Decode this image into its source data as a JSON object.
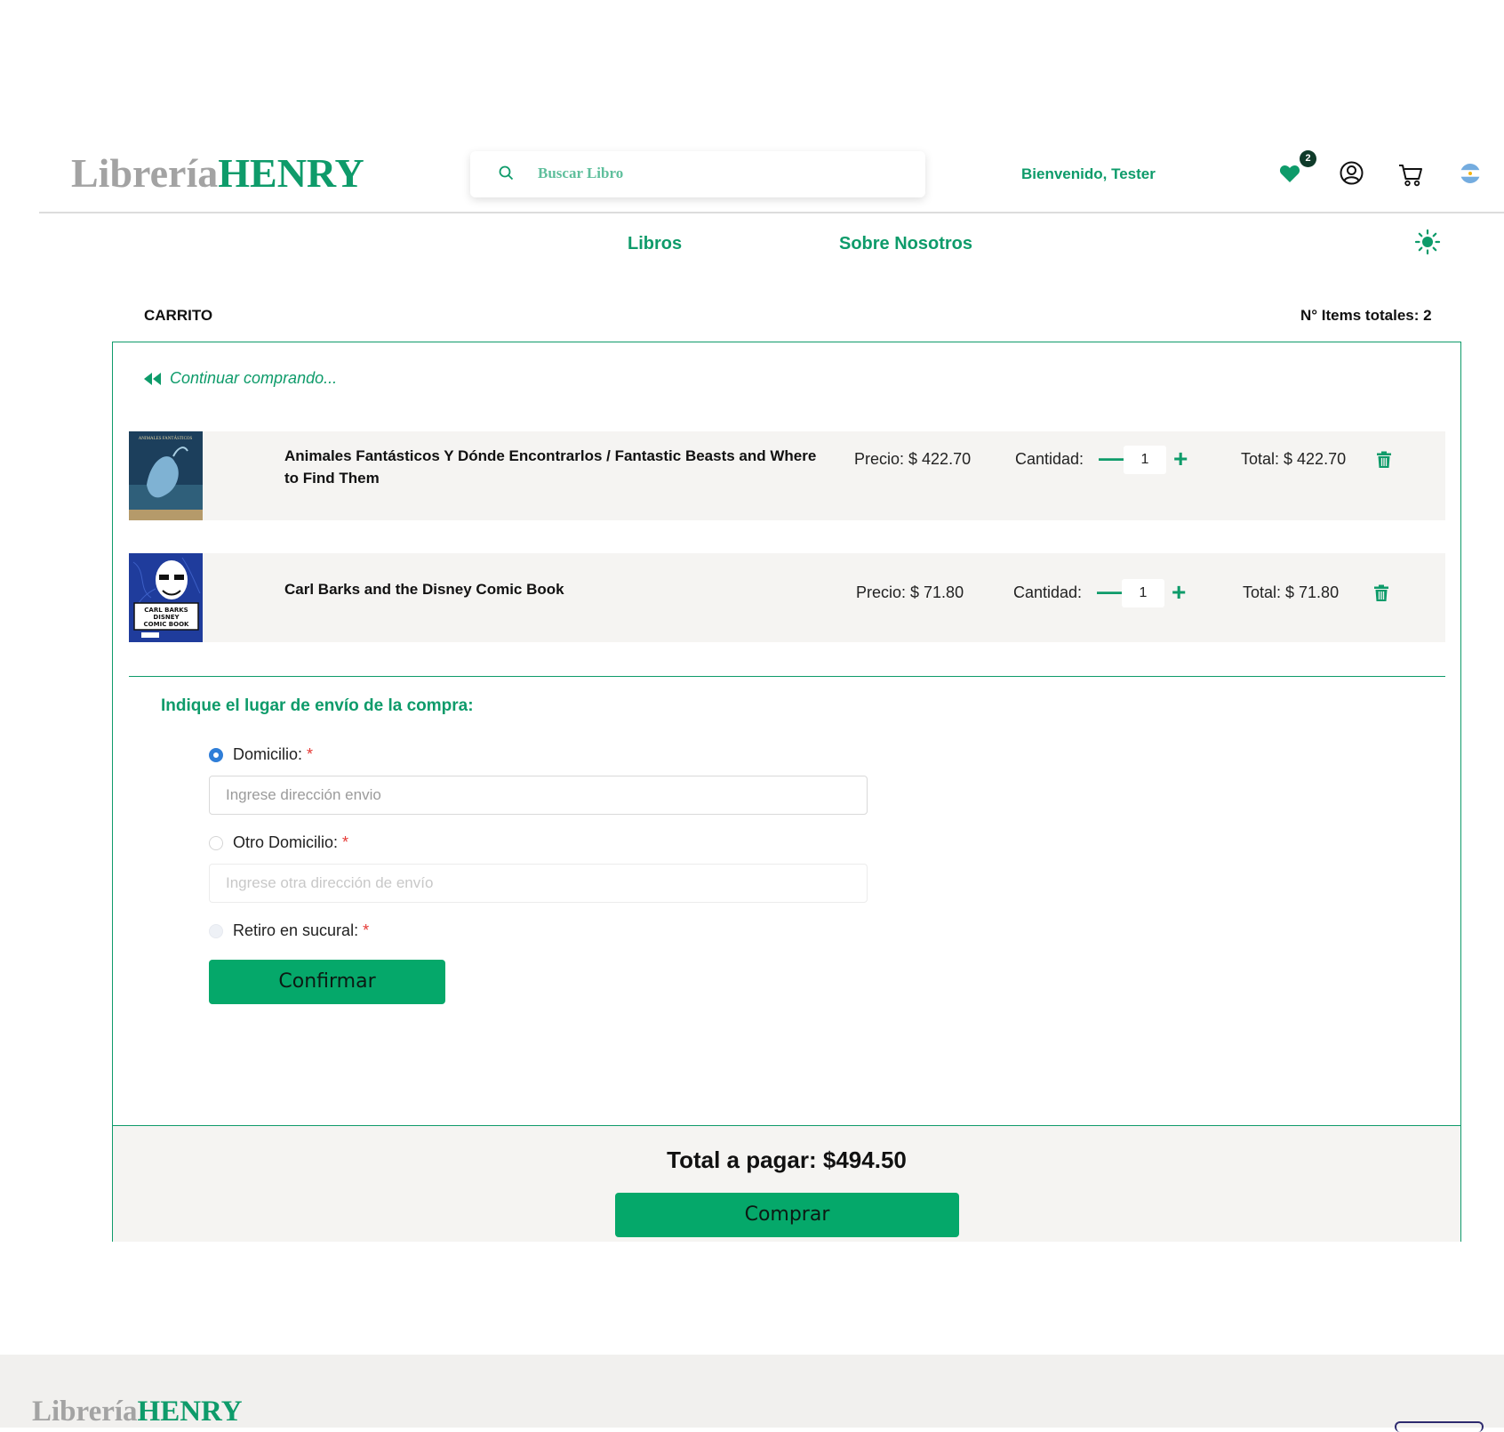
{
  "header": {
    "logo_part1": "Librería",
    "logo_part2": "HENRY",
    "search_placeholder": "Buscar Libro",
    "welcome": "Bienvenido, Tester",
    "favorites_count": "2"
  },
  "nav": {
    "books": "Libros",
    "about": "Sobre Nosotros"
  },
  "cart": {
    "title": "CARRITO",
    "items_total": "N° Items totales: 2",
    "continue_label": "Continuar comprando...",
    "items": [
      {
        "title": "Animales Fantásticos Y Dónde Encontrarlos / Fantastic Beasts and Where to Find Them",
        "price": "Precio: $ 422.70",
        "qty_label": "Cantidad:",
        "qty": "1",
        "total": "Total: $ 422.70"
      },
      {
        "title": "Carl Barks and the Disney Comic Book",
        "price": "Precio: $ 71.80",
        "qty_label": "Cantidad:",
        "qty": "1",
        "total": "Total: $ 71.80"
      }
    ],
    "book1_cover_text": "ANIMALES FANTÁSTICOS",
    "book2_cover_text": [
      "CARL BARKS",
      "DISNEY",
      "COMIC BOOK"
    ]
  },
  "shipping": {
    "title": "Indique el lugar de envío de la compra:",
    "option_home": "Domicilio:",
    "home_placeholder": "Ingrese dirección envio",
    "option_other": "Otro Domicilio:",
    "other_placeholder": "Ingrese otra dirección de envío",
    "option_pickup": "Retiro en sucural:",
    "required_mark": "*",
    "confirm_label": "Confirmar"
  },
  "summary": {
    "total_label": "Total a pagar: $494.50",
    "buy_label": "Comprar"
  },
  "footer": {
    "logo_part1": "Librería",
    "logo_part2": "HENRY"
  },
  "colors": {
    "brand_green": "#0e9b6a",
    "button_green": "#05a86a",
    "radio_blue": "#2f7ed8"
  }
}
